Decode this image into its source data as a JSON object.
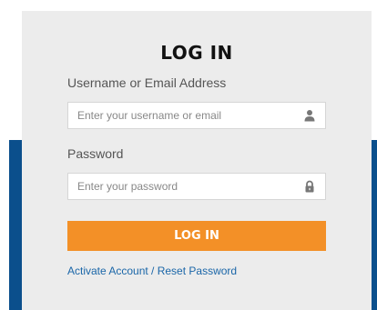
{
  "login": {
    "title": "LOG IN",
    "username_label": "Username or Email Address",
    "username_placeholder": "Enter your username or email",
    "username_value": "",
    "password_label": "Password",
    "password_placeholder": "Enter your password",
    "password_value": "",
    "submit_label": "LOG IN",
    "activate_link": "Activate Account / Reset Password"
  },
  "icons": {
    "username": "user-icon",
    "password": "lock-icon"
  },
  "colors": {
    "card_bg": "#ececec",
    "accent_band": "#0b4f8c",
    "button": "#f39027",
    "link": "#1a66a8"
  }
}
